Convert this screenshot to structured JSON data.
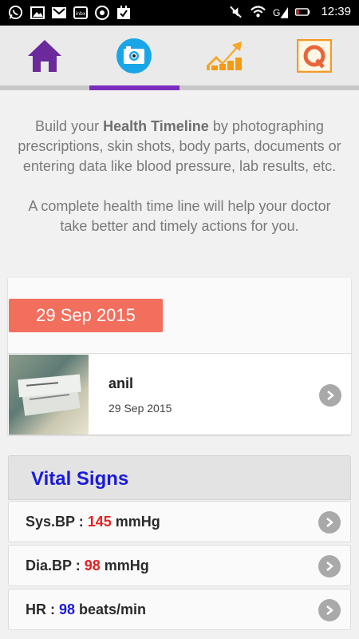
{
  "status_bar": {
    "time": "12:39",
    "icons": [
      "whatsapp-icon",
      "image-icon",
      "gmail-icon",
      "inbox-icon",
      "chrome-icon",
      "task-icon",
      "mute-icon",
      "wifi-icon",
      "signal-icon",
      "battery-icon"
    ]
  },
  "tabs": [
    {
      "name": "home",
      "icon": "home-icon",
      "active": false
    },
    {
      "name": "camera",
      "icon": "camera-icon",
      "active": true
    },
    {
      "name": "trends",
      "icon": "chart-icon",
      "active": false
    },
    {
      "name": "query",
      "icon": "q-icon",
      "active": false
    }
  ],
  "intro": {
    "line1_pre": "Build your ",
    "line1_bold": "Health Timeline",
    "line1_post": " by photographing prescriptions, skin shots, body parts, documents or entering data like blood pressure, lab results, etc.",
    "line2": "A complete health time line will help your doctor take better and timely actions for you."
  },
  "timeline": {
    "date_badge": "29 Sep 2015",
    "entry": {
      "name": "anil",
      "date": "29 Sep 2015"
    }
  },
  "vitals": {
    "title": "Vital Signs",
    "rows": [
      {
        "label": "Sys.BP : ",
        "value": "145",
        "unit": " mmHg",
        "value_color": "red"
      },
      {
        "label": "Dia.BP : ",
        "value": "98",
        "unit": " mmHg",
        "value_color": "red"
      },
      {
        "label": "HR : ",
        "value": "98",
        "unit": " beats/min",
        "value_color": "blue"
      }
    ]
  },
  "colors": {
    "accent": "#7b2cbf",
    "badge": "#f26f5e",
    "vital_title": "#1a1adb",
    "value_red": "#e62020",
    "value_blue": "#1a1adb"
  }
}
